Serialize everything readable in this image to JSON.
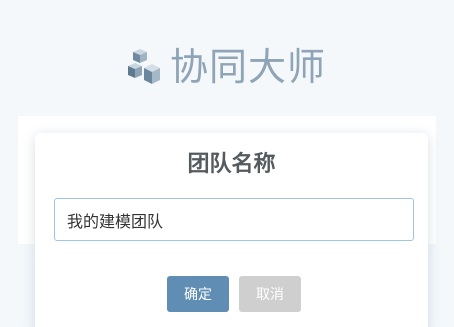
{
  "brand": {
    "title": "协同大师",
    "logo_icon": "cube-stack-icon",
    "title_color": "#8fa4b6"
  },
  "dialog": {
    "title": "团队名称",
    "input": {
      "value": "我的建模团队",
      "placeholder": ""
    },
    "buttons": {
      "confirm_label": "确定",
      "cancel_label": "取消"
    }
  },
  "colors": {
    "accent": "#5f8db3",
    "disabled": "#cfcfcf",
    "input_border": "#9cc6e6",
    "background": "#f4f8fb"
  }
}
